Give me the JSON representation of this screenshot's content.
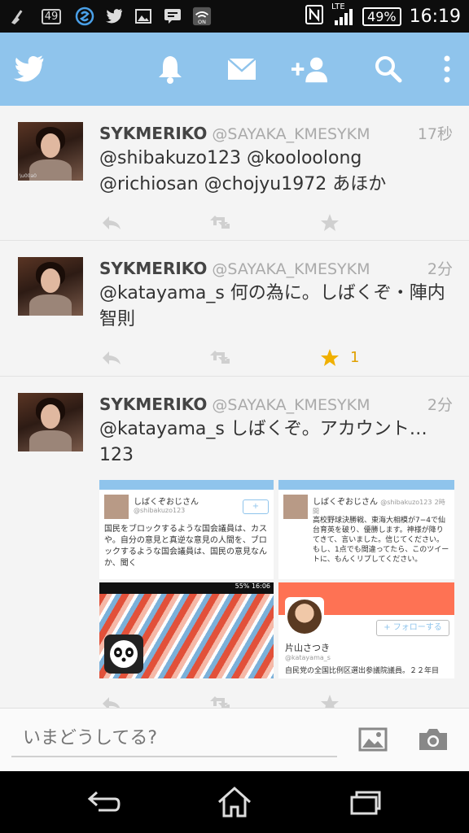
{
  "status_bar": {
    "notif_count": "49",
    "network": "LTE",
    "battery": "49%",
    "time": "16:19"
  },
  "header": {
    "icons": [
      "twitter-bird-icon",
      "bell-icon",
      "mail-icon",
      "add-user-icon",
      "search-icon",
      "overflow-menu-icon"
    ]
  },
  "tweets": [
    {
      "name": "SYKMERIKO",
      "handle": "@SAYAKA_KMESYKM",
      "time": "17秒",
      "text": "@shibakuzo123 @kooloolong @richiosan @chojyu1972 あほか",
      "fav_count": ""
    },
    {
      "name": "SYKMERIKO",
      "handle": "@SAYAKA_KMESYKM",
      "time": "2分",
      "text": "@katayama_s 何の為に。しばくぞ・陣内智則",
      "fav_count": "1"
    },
    {
      "name": "SYKMERIKO",
      "handle": "@SAYAKA_KMESYKM",
      "time": "2分",
      "text": "@katayama_s しばくぞ。アカウント…123",
      "fav_count": ""
    }
  ],
  "media": {
    "m1": {
      "name": "しばくぞおじさん",
      "handle": "@shibakuzo123",
      "text": "国民をブロックするような国会議員は、カスや。自分の意見と真逆な意見の人間を、ブロックするような国会議員は、国民の意見なんか、聞く"
    },
    "m2": {
      "name": "しばくぞおじさん",
      "handle": "@shibakuzo123",
      "time": "2時間",
      "text": "高校野球決勝戦、東海大相模が7−4で仙台育英を破り、優勝します。神様が降りてきて、言いました。信じてください。もし、1点でも間違ってたら、このツイートに、もんくリプしてください。"
    },
    "m3": {
      "status_time": "16:06",
      "status_battery": "55%"
    },
    "m4": {
      "follow_label": "フォローする",
      "name": "片山さつき",
      "handle": "@katayama_s",
      "bio": "自民党の全国比例区選出参議院議員。２２年目"
    }
  },
  "compose": {
    "placeholder": "いまどうしてる?"
  },
  "colors": {
    "header_bg": "#8fc4ec",
    "fav_active": "#f0b000",
    "profile_banner": "#fe7254"
  }
}
